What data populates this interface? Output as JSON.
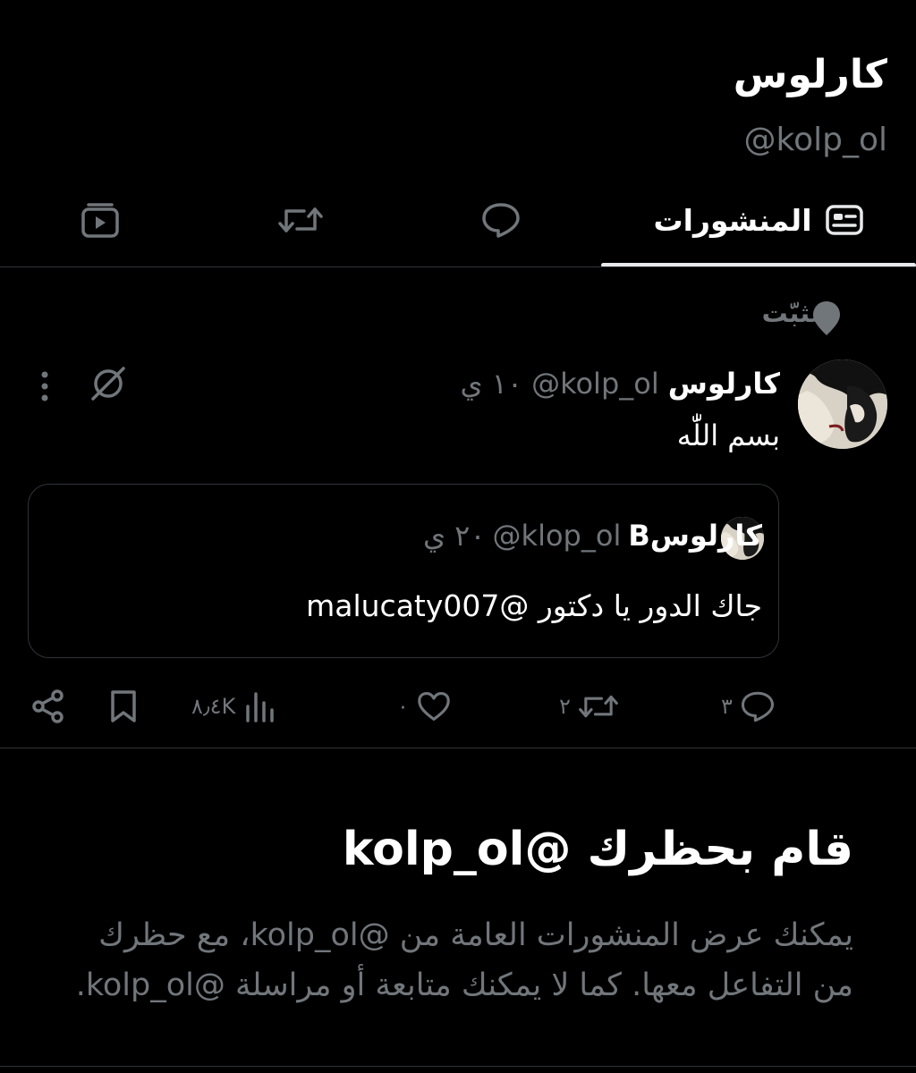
{
  "profile": {
    "name": "كارلوس",
    "handle": "@kolp_ol"
  },
  "tabs": {
    "posts_label": "المنشورات"
  },
  "pinned": {
    "label": "مُثبّت"
  },
  "tweet": {
    "name": "كارلوس",
    "handle": "@kolp_ol",
    "time": "١٠ ي",
    "text": "بسم اللّٰه"
  },
  "quote": {
    "name": "كارلوسB",
    "handle": "@klop_ol",
    "time": "٢٠ ي",
    "text": "جاك الدور يا دكتور @malucaty007"
  },
  "actions": {
    "replies": "٣",
    "retweets": "٢",
    "likes": "٠",
    "views": "٨٫٤K"
  },
  "blocked": {
    "title": "قام بحظرك @kolp_ol",
    "description": "يمكنك عرض المنشورات العامة من @kolp_ol، مع حظرك من التفاعل معها. كما لا يمكنك متابعة أو مراسلة @kolp_ol."
  },
  "colors": {
    "background": "#000000",
    "text": "#e7e9ea",
    "secondary": "#71767b",
    "border": "#2f3336"
  }
}
